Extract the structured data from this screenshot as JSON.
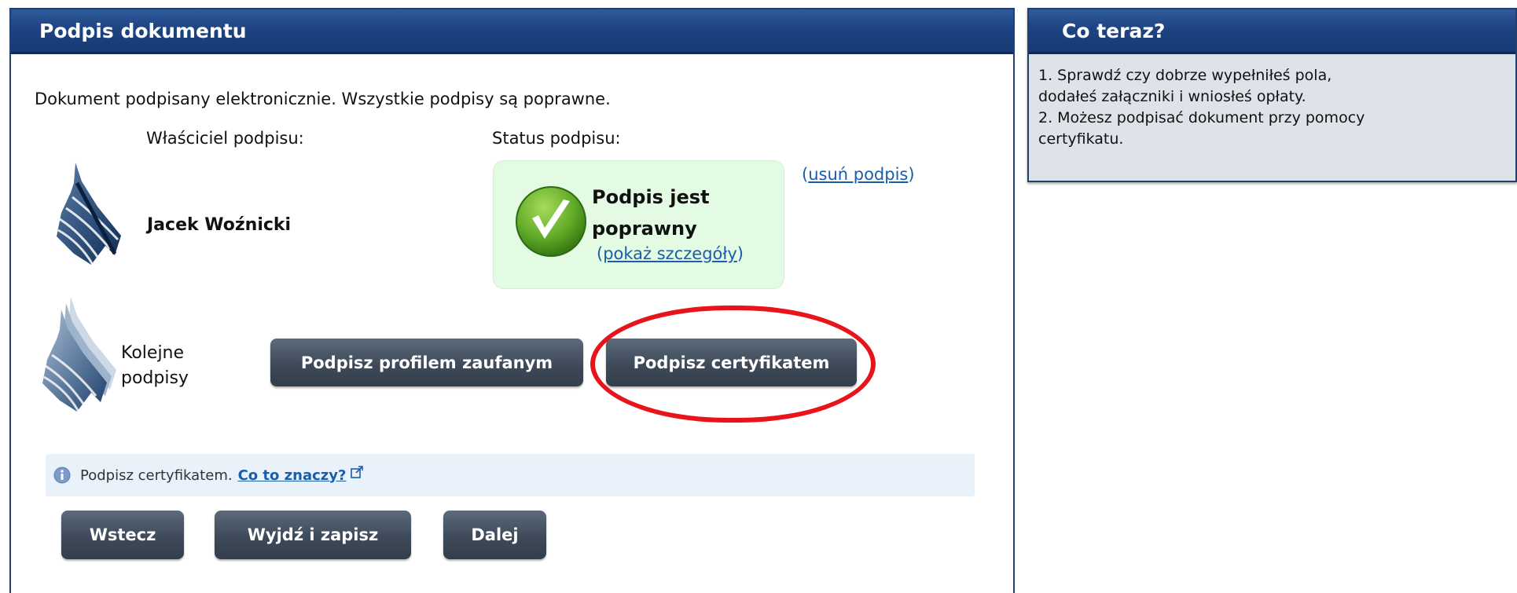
{
  "panel": {
    "title": "Podpis dokumentu",
    "intro": "Dokument podpisany elektronicznie. Wszystkie podpisy są poprawne.",
    "owner_label": "Właściciel podpisu:",
    "status_label": "Status podpisu:",
    "owner_name": "Jacek Woźnicki",
    "status_text": "Podpis jest poprawny",
    "details_open": "(",
    "details_link": "pokaż szczegóły",
    "details_close": ")",
    "remove_open": "(",
    "remove_link": "usuń podpis",
    "remove_close": ")",
    "next_signatures_label": "Kolejne podpisy",
    "sign_profile_button": "Podpisz profilem zaufanym",
    "sign_certificate_button": "Podpisz certyfikatem",
    "info_text": "Podpisz certyfikatem.",
    "info_link": "Co to znaczy?",
    "back_button": "Wstecz",
    "exit_save_button": "Wyjdź i zapisz",
    "next_button": "Dalej"
  },
  "side": {
    "title": "Co teraz?",
    "lines": [
      "1. Sprawdź czy dobrze wypełniłeś pola,",
      "dodałeś załączniki i wniosłeś opłaty.",
      "2. Możesz podpisać dokument przy pomocy",
      "certyfikatu."
    ]
  },
  "colors": {
    "header_blue": "#1e4382",
    "button_gray": "#3e4a59",
    "status_green_bg": "#e2fbe2",
    "link_blue": "#1a5dab",
    "highlight_red": "#e8141c"
  },
  "icons": [
    "feather-logo-icon",
    "checkmark-icon",
    "info-icon",
    "external-link-icon"
  ]
}
